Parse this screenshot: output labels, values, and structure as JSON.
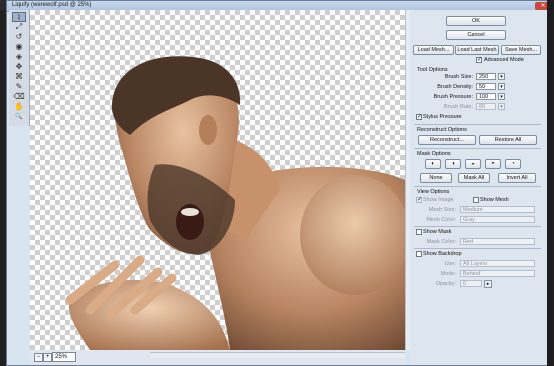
{
  "window": {
    "title": "Liquify (werewolf.psd @ 25%)",
    "close_label": "✕"
  },
  "toolbox": {
    "tools": [
      "⌇",
      "⤢",
      "↺",
      "◉",
      "◈",
      "✥",
      "⌘",
      "✎",
      "⌫",
      "✋",
      "🔍"
    ]
  },
  "status": {
    "zoom": "25%",
    "minus": "−",
    "plus": "+"
  },
  "panel": {
    "ok": "OK",
    "cancel": "Cancel",
    "load_mesh": "Load Mesh...",
    "load_last_mesh": "Load Last Mesh",
    "save_mesh": "Save Mesh...",
    "advanced_mode": "Advanced Mode",
    "tool_options": {
      "heading": "Tool Options",
      "rows": [
        {
          "label": "Brush Size:",
          "value": "250"
        },
        {
          "label": "Brush Density:",
          "value": "50"
        },
        {
          "label": "Brush Pressure:",
          "value": "100"
        },
        {
          "label": "Brush Rate:",
          "value": "80"
        }
      ],
      "stylus_pressure": "Stylus Pressure"
    },
    "reconstruct": {
      "heading": "Reconstruct Options",
      "reconstruct_btn": "Reconstruct...",
      "restore_all": "Restore All"
    },
    "mask": {
      "heading": "Mask Options",
      "none": "None",
      "mask_all": "Mask All",
      "invert_all": "Invert All"
    },
    "view": {
      "heading": "View Options",
      "show_image": "Show Image",
      "show_mesh": "Show Mesh",
      "mesh_size_label": "Mesh Size:",
      "mesh_size": "Medium",
      "mesh_color_label": "Mesh Color:",
      "mesh_color": "Gray",
      "show_mask": "Show Mask",
      "mask_color_label": "Mask Color:",
      "mask_color": "Red",
      "show_backdrop": "Show Backdrop",
      "use_label": "Use:",
      "use": "All Layers",
      "mode_label": "Mode:",
      "mode": "Behind",
      "opacity_label": "Opacity:",
      "opacity": "0"
    }
  }
}
